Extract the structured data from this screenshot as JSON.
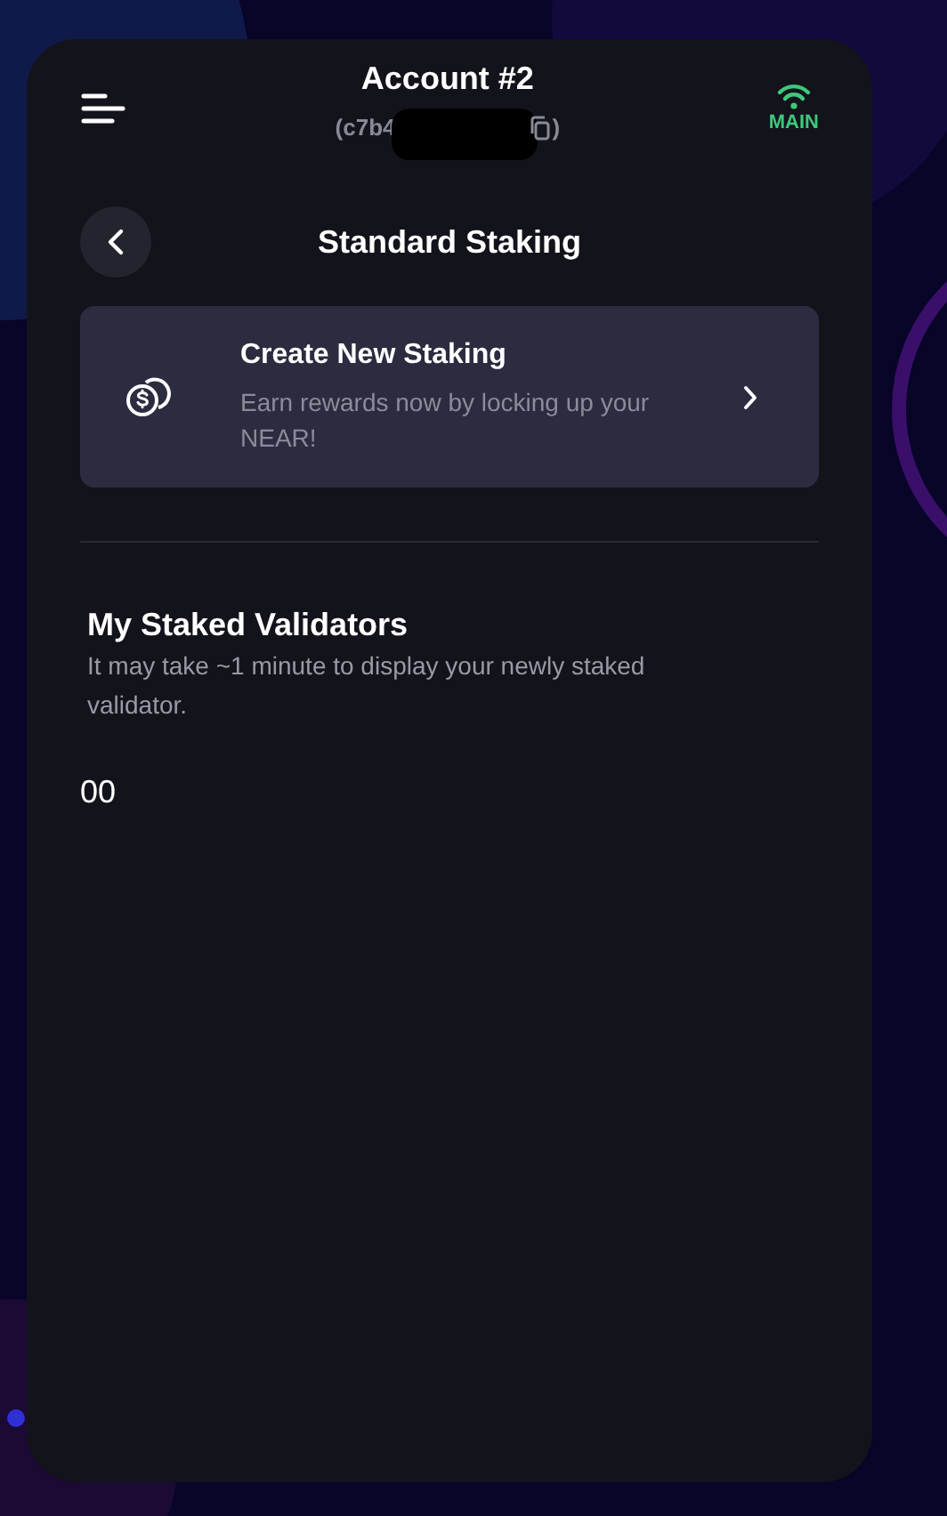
{
  "header": {
    "account_name": "Account #2",
    "address_prefix": "(c7b4",
    "address_suffix": ")",
    "network": "MAIN"
  },
  "page": {
    "title": "Standard Staking"
  },
  "create_card": {
    "title": "Create New Staking",
    "description": "Earn rewards now by locking up your NEAR!"
  },
  "validators": {
    "heading": "My Staked Validators",
    "note": "It may take ~1 minute to display your newly staked validator.",
    "value": "00"
  }
}
